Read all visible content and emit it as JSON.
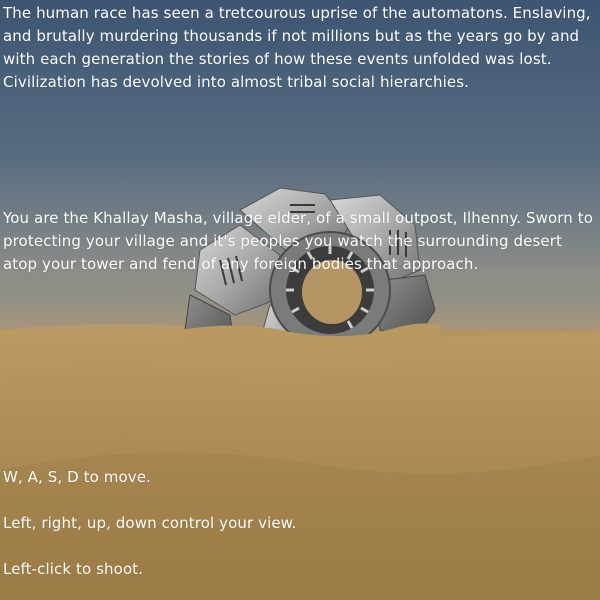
{
  "story": {
    "intro": "The human race has seen a tretcourous uprise of the automatons. Enslaving, and brutally murdering thousands if not millions but as the years go by and with each generation the stories of how these events unfolded was lost. Civilization has devolved into almost tribal social hierarchies.",
    "role": "You are the Khallay Masha, village elder, of a small outpost, Ilhenny. Sworn to protecting your village and it's peoples you watch the surrounding desert atop your tower and fend of any foreign bodies that approach."
  },
  "controls": {
    "move": "W, A, S, D to move.",
    "view": "Left, right, up, down control your view.",
    "shoot": "Left-click to shoot."
  },
  "colors": {
    "sky_top": "#3d5572",
    "sand": "#b08c56",
    "text": "#ffffff"
  }
}
